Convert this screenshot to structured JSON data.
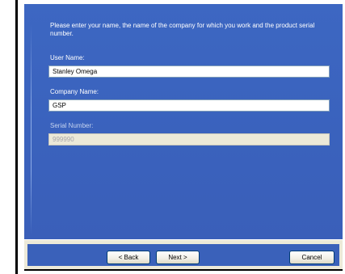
{
  "instructions": "Please enter your name, the name of the company for which you work and the product serial number.",
  "fields": {
    "user_name": {
      "label": "User Name:",
      "value": "Stanley Omega"
    },
    "company_name": {
      "label": "Company Name:",
      "value": "GSP"
    },
    "serial_number": {
      "label": "Serial Number:",
      "value": "999990"
    }
  },
  "buttons": {
    "back": "< Back",
    "next": "Next >",
    "cancel": "Cancel"
  },
  "colors": {
    "panel": "#3d67c2",
    "button_bar": "#3a61ba",
    "chrome": "#ece9d8"
  }
}
